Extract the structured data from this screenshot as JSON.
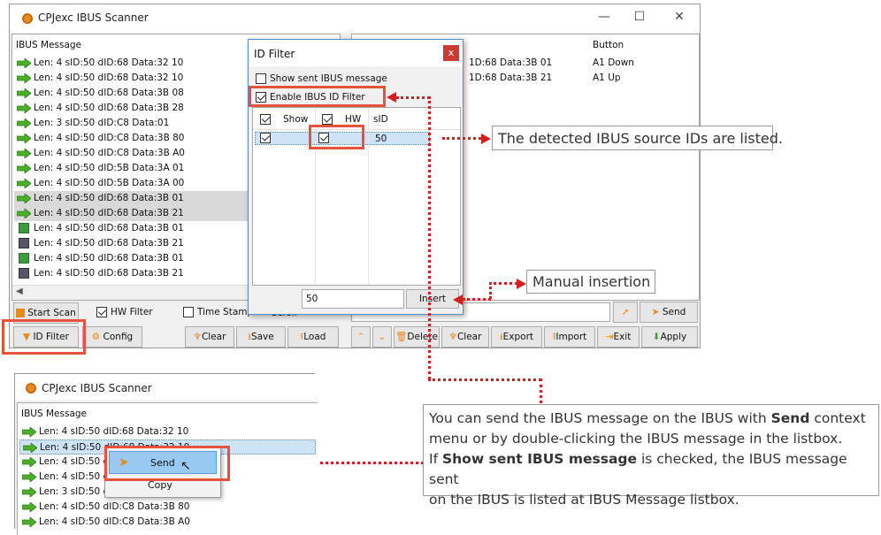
{
  "main_window": {
    "title": "CPJexc IBUS Scanner",
    "caption_minimize": "—",
    "caption_maximize": "☐",
    "caption_close": "✕",
    "ibus_header": "IBUS Message",
    "button_header": "Button",
    "messages": [
      {
        "text": "Len: 4 sID:50 dID:68 Data:32 10",
        "icon": "green-arrow-icon"
      },
      {
        "text": "Len: 4 sID:50 dID:68 Data:32 10",
        "icon": "green-arrow-icon"
      },
      {
        "text": "Len: 4 sID:50 dID:68 Data:3B 08",
        "icon": "green-arrow-icon"
      },
      {
        "text": "Len: 4 sID:50 dID:68 Data:3B 28",
        "icon": "green-arrow-icon"
      },
      {
        "text": "Len: 3 sID:50 dID:C8 Data:01",
        "icon": "green-arrow-icon"
      },
      {
        "text": "Len: 4 sID:50 dID:C8 Data:3B 80",
        "icon": "green-arrow-icon"
      },
      {
        "text": "Len: 4 sID:50 dID:C8 Data:3B A0",
        "icon": "green-arrow-icon"
      },
      {
        "text": "Len: 4 sID:50 dID:5B Data:3A 01",
        "icon": "green-arrow-icon"
      },
      {
        "text": "Len: 4 sID:50 dID:5B Data:3A 00",
        "icon": "green-arrow-icon"
      },
      {
        "text": "Len: 4 sID:50 dID:68 Data:3B 01",
        "icon": "green-arrow-icon"
      },
      {
        "text": "Len: 4 sID:50 dID:68 Data:3B 21",
        "icon": "green-arrow-icon"
      },
      {
        "text": "Len: 4 sID:50 dID:68 Data:3B 01",
        "icon": "green-square-icon"
      },
      {
        "text": "Len: 4 sID:50 dID:68 Data:3B 21",
        "icon": "gray-square-icon"
      },
      {
        "text": "Len: 4 sID:50 dID:68 Data:3B 01",
        "icon": "green-square-icon"
      },
      {
        "text": "Len: 4 sID:50 dID:68 Data:3B 21",
        "icon": "gray-square-icon"
      }
    ],
    "right_rows": [
      {
        "text": "1D:68 Data:3B 01",
        "button": "A1 Down"
      },
      {
        "text": "1D:68 Data:3B 21",
        "button": "A1 Up"
      }
    ],
    "start_scan": "Start Scan",
    "hw_filter": "HW Filter",
    "time_stamp": "Time Stamp",
    "scroll": "Scroll",
    "id_filter": "ID Filter",
    "config": "Config",
    "clear": "Clear",
    "save": "Save",
    "load": "Load",
    "send": "Send",
    "delete": "Delete",
    "clear2": "Clear",
    "export": "Export",
    "import": "Import",
    "exit": "Exit",
    "apply": "Apply"
  },
  "id_filter_dialog": {
    "title": "ID Filter",
    "close": "x",
    "show_sent": "Show sent IBUS message",
    "enable_filter": "Enable IBUS ID Filter",
    "col_show": "Show",
    "col_hw": "HW",
    "col_sid": "sID",
    "row_sid": "50",
    "insert_value": "50",
    "insert_button": "Insert"
  },
  "second_window": {
    "title": "CPJexc IBUS Scanner",
    "ibus_header": "IBUS Message",
    "messages": [
      "Len: 4 sID:50 dID:68 Data:32 10",
      "Len: 4 sID:50 dID:68 Data:32 10",
      "Len: 4 sID:50 dID:",
      "Len: 4 sID:50 dID:",
      "Len: 3 sID:50 dID:",
      "Len: 4 sID:50 dID:C8 Data:3B 80",
      "Len: 4 sID:50 dID:C8 Data:3B A0"
    ],
    "context_send": "Send",
    "context_copy": "Copy"
  },
  "annotations": {
    "detected_ids": "The detected IBUS source IDs are listed.",
    "manual_insertion": "Manual insertion",
    "help_line1_a": "You can send the IBUS message on the IBUS with ",
    "help_line1_b": "Send",
    "help_line1_c": " context",
    "help_line2": "menu or by double-clicking the IBUS message in the listbox.",
    "help_line3_a": "If ",
    "help_line3_b": "Show sent IBUS message",
    "help_line3_c": " is checked, the IBUS message sent",
    "help_line4": "on the IBUS is listed at IBUS Message listbox."
  },
  "colors": {
    "highlight_box": "#e5533d",
    "dotted_arrow": "#d21f1f",
    "selection": "#d9d9d9",
    "context_highlight": "#99c9f0"
  }
}
